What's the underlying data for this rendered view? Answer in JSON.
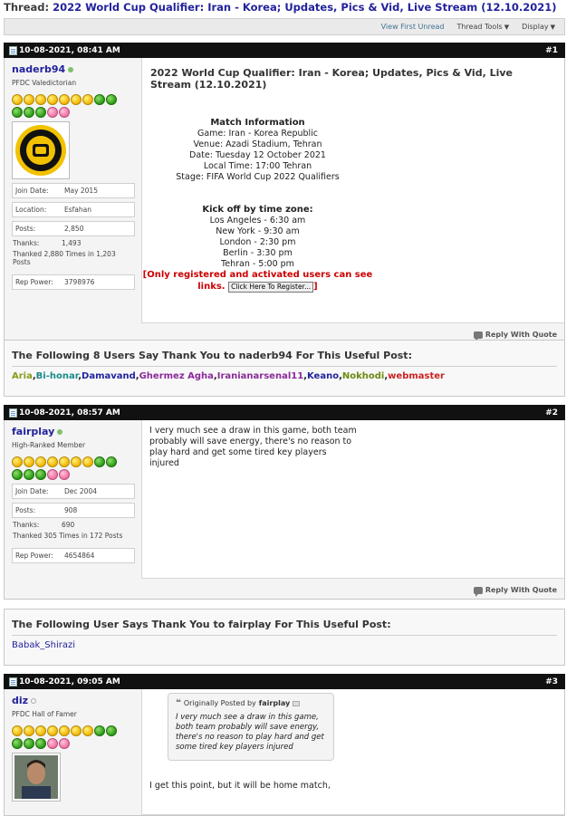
{
  "thread": {
    "prefix": "Thread:",
    "title": "2022 World Cup Qualifier: Iran - Korea; Updates, Pics & Vid, Live Stream (12.10.2021)"
  },
  "toolbar": {
    "view_first_unread": "View First Unread",
    "thread_tools": "Thread Tools",
    "display": "Display"
  },
  "posts": [
    {
      "date": "10-08-2021, 08:41 AM",
      "number": "#1",
      "username": "naderb94",
      "usertitle": "PFDC Valedictorian",
      "join_label": "Join Date:",
      "join_date": "May 2015",
      "location_label": "Location:",
      "location": "Esfahan",
      "posts_label": "Posts:",
      "posts": "2,850",
      "thanks_label": "Thanks:",
      "thanks": "1,493",
      "thanked_line": "Thanked 2,880 Times in 1,203 Posts",
      "rep_label": "Rep Power:",
      "rep_power": "3798976",
      "reply_label": "Reply With Quote",
      "title": "2022 World Cup Qualifier: Iran - Korea; Updates, Pics & Vid, Live Stream (12.10.2021)",
      "match_info": {
        "heading": "Match Information",
        "lines": [
          "Game: Iran - Korea Republic",
          "Venue: Azadi Stadium, Tehran",
          "Date: Tuesday 12 October 2021",
          "Local Time: 17:00 Tehran",
          "Stage: FIFA World Cup 2022 Qualifiers"
        ]
      },
      "kickoff": {
        "heading": "Kick off by time zone:",
        "lines": [
          "Los Angeles - 6:30 am",
          "New York - 9:30 am",
          "London - 2:30 pm",
          "Berlin - 3:30 pm",
          "Tehran - 5:00 pm"
        ]
      },
      "warning_pre": "[Only registered and activated users can see links.",
      "register_button": "Click Here To Register...",
      "warning_post": "]"
    },
    {
      "date": "10-08-2021, 08:57 AM",
      "number": "#2",
      "username": "fairplay",
      "usertitle": "High-Ranked Member",
      "join_label": "Join Date:",
      "join_date": "Dec 2004",
      "posts_label": "Posts:",
      "posts": "908",
      "thanks_label": "Thanks:",
      "thanks": "690",
      "thanked_line": "Thanked 305 Times in 172 Posts",
      "rep_label": "Rep Power:",
      "rep_power": "4654864",
      "reply_label": "Reply With Quote",
      "text": "I very much see a draw in this game, both team probably will save energy, there's no reason to play hard and get some tired key players injured"
    },
    {
      "date": "10-08-2021, 09:05 AM",
      "number": "#3",
      "username": "diz",
      "usertitle": "PFDC Hall of Famer",
      "quote_prefix": "Originally Posted by",
      "quote_author": "fairplay",
      "quote_text": "I very much see a draw in this game, both team probably will save energy, there's no reason to play hard and get some tired key players injured",
      "text": "I get this point, but it will be home match,"
    }
  ],
  "thanks_boxes": [
    {
      "title": "The Following 8 Users Say Thank You to naderb94 For This Useful Post:",
      "users": [
        {
          "name": "Aria",
          "color": "#8a9a1a"
        },
        {
          "name": "Bi-honar",
          "color": "#1a8a8a"
        },
        {
          "name": "Damavand",
          "color": "#22229c"
        },
        {
          "name": "Ghermez Agha",
          "color": "#8a2a9a"
        },
        {
          "name": "Iranianarsenal11",
          "color": "#8a2a9a"
        },
        {
          "name": "Keano",
          "color": "#22229c"
        },
        {
          "name": "Nokhodi",
          "color": "#6a8a10"
        },
        {
          "name": "webmaster",
          "color": "#cc2222"
        }
      ]
    },
    {
      "title": "The Following User Says Thank You to fairplay For This Useful Post:",
      "users": [
        {
          "name": "Babak_Shirazi",
          "color": "#22229c"
        }
      ]
    }
  ]
}
